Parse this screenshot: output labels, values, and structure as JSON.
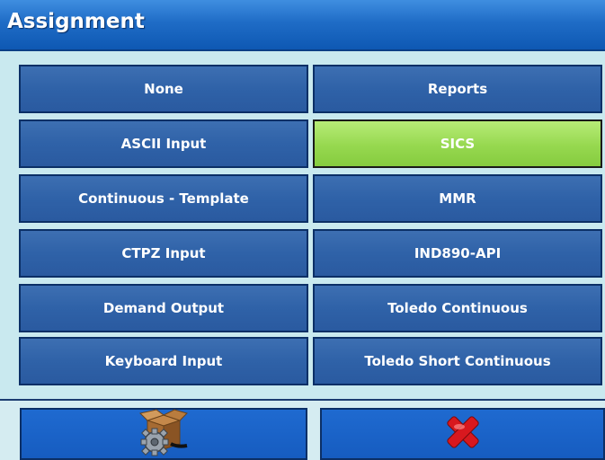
{
  "header": {
    "title": "Assignment"
  },
  "options": {
    "left": [
      {
        "label": "None"
      },
      {
        "label": "ASCII Input"
      },
      {
        "label": "Continuous - Template"
      },
      {
        "label": "CTPZ Input"
      },
      {
        "label": "Demand Output"
      },
      {
        "label": "Keyboard Input"
      }
    ],
    "right": [
      {
        "label": "Reports"
      },
      {
        "label": "SICS",
        "selected": true
      },
      {
        "label": "MMR"
      },
      {
        "label": "IND890-API"
      },
      {
        "label": "Toledo Continuous"
      },
      {
        "label": "Toledo Short Continuous"
      }
    ]
  },
  "softkeys": [
    {
      "icon": "settings-box-icon"
    },
    {
      "icon": "cancel-x-icon"
    }
  ],
  "colors": {
    "button_blue": "#2f62a8",
    "selected_green": "#96d84f",
    "title_blue": "#1f6cc6",
    "cancel_red": "#d8181e"
  }
}
